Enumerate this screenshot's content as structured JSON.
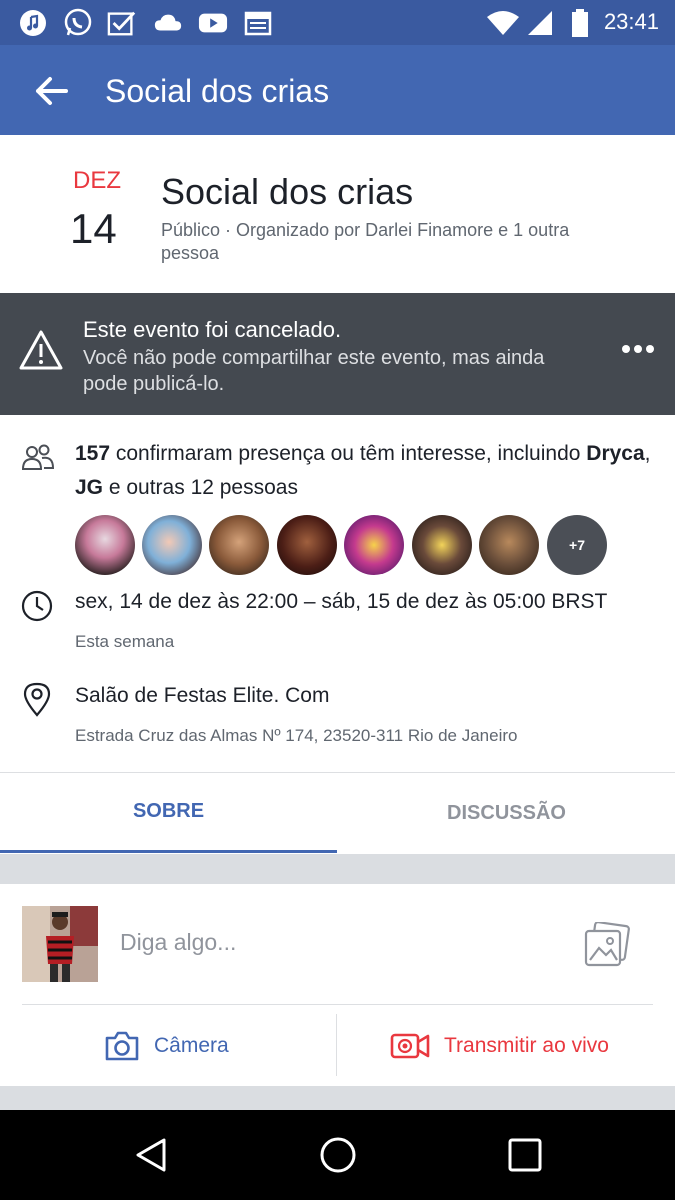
{
  "status_bar": {
    "time": "23:41",
    "icons": [
      "music-icon",
      "whatsapp-icon",
      "check-box-icon",
      "cloud-icon",
      "youtube-icon",
      "calendar-icon",
      "wifi-icon",
      "signal-icon",
      "battery-icon"
    ]
  },
  "app_bar": {
    "title": "Social dos crias"
  },
  "event": {
    "month": "DEZ",
    "day": "14",
    "title": "Social dos crias",
    "subtitle": "Público · Organizado por Darlei Finamore e 1 outra pessoa"
  },
  "cancel_banner": {
    "title": "Este evento foi cancelado.",
    "message": "Você não pode compartilhar este evento, mas ainda pode publicá-lo."
  },
  "attendance": {
    "count": "157",
    "text": " confirmaram presença ou têm interesse, incluindo ",
    "name1": "Dryca",
    "sep": ", ",
    "name2": "JG",
    "rest": " e outras 12 pessoas",
    "more_count": "+7"
  },
  "datetime": {
    "text": "sex, 14 de dez às 22:00 – sáb, 15 de dez às 05:00 BRST",
    "sub": "Esta semana"
  },
  "location": {
    "name": "Salão de Festas Elite. Com",
    "address": "Estrada Cruz das Almas Nº 174, 23520-311 Rio de Janeiro"
  },
  "tabs": {
    "about": "SOBRE",
    "discussion": "DISCUSSÃO"
  },
  "composer": {
    "placeholder": "Diga algo...",
    "camera": "Câmera",
    "live": "Transmitir ao vivo"
  },
  "colors": {
    "brand": "#4267b2",
    "status_bar": "#3a5aa0",
    "accent_red": "#e9383f",
    "banner": "#444950"
  }
}
